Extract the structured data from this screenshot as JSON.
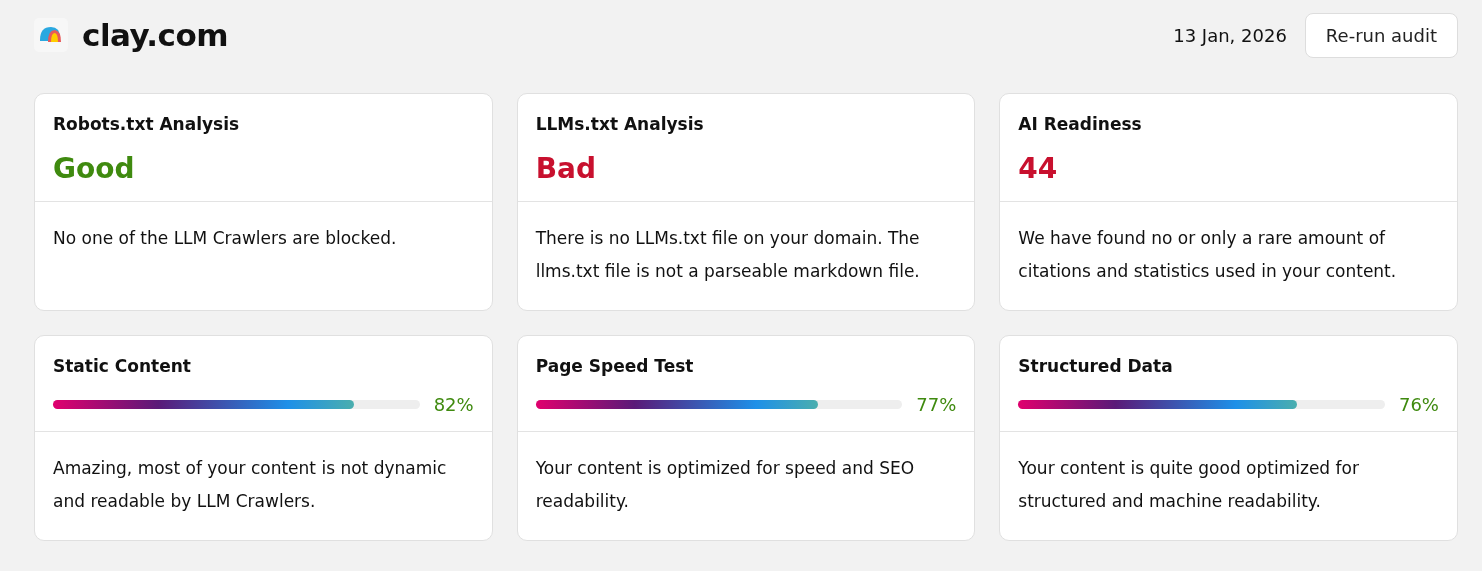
{
  "header": {
    "site": "clay.com",
    "date": "13 Jan, 2026",
    "button": "Re-run audit"
  },
  "cards": [
    {
      "kind": "status",
      "title": "Robots.txt Analysis",
      "value": "Good",
      "color": "#3f8a0f",
      "description": "No one of the LLM Crawlers are blocked."
    },
    {
      "kind": "status",
      "title": "LLMs.txt Analysis",
      "value": "Bad",
      "color": "#c8102e",
      "description": "There is no LLMs.txt file on your domain. The llms.txt file is not a parseable markdown file."
    },
    {
      "kind": "status",
      "title": "AI Readiness",
      "value": "44",
      "color": "#c8102e",
      "description": "We have found no or only a rare amount of citations and statistics used in your content."
    },
    {
      "kind": "progress",
      "title": "Static Content",
      "level": 0.82,
      "value": "82%",
      "color": "#3f8a0f",
      "description": "Amazing, most of your content is not dynamic and readable by LLM Crawlers."
    },
    {
      "kind": "progress",
      "title": "Page Speed Test",
      "level": 0.77,
      "value": "77%",
      "color": "#3f8a0f",
      "description": "Your content is optimized for speed and SEO readability."
    },
    {
      "kind": "progress",
      "title": "Structured Data",
      "level": 0.76,
      "value": "76%",
      "color": "#3f8a0f",
      "description": "Your content is quite good optimized for structured and machine readability."
    }
  ]
}
